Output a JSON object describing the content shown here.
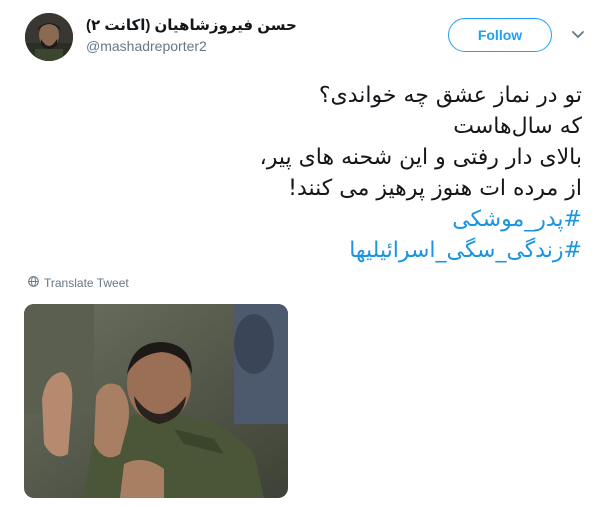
{
  "tweet": {
    "author_name": "حسن فیروزشاهیان (اکانت ۲)",
    "author_handle": "@mashadreporter2",
    "follow_label": "Follow",
    "lines": [
      "تو در نماز عشق چه خواندی؟",
      "که سال‌هاست",
      "بالای دار رفتی و این شحنه های پیر،",
      "از مرده ات هنوز پرهیز می کنند!"
    ],
    "hashtags": [
      "#پدر_موشکی",
      "#زندگی_سگی_اسرائیلیها"
    ],
    "translate_label": "Translate Tweet",
    "colors": {
      "accent": "#1da1f2",
      "hashtag": "#1b95e0",
      "secondary_text": "#657786",
      "primary_text": "#14171a"
    },
    "icons": {
      "more": "chevron-down-icon",
      "translate": "globe-icon"
    }
  }
}
